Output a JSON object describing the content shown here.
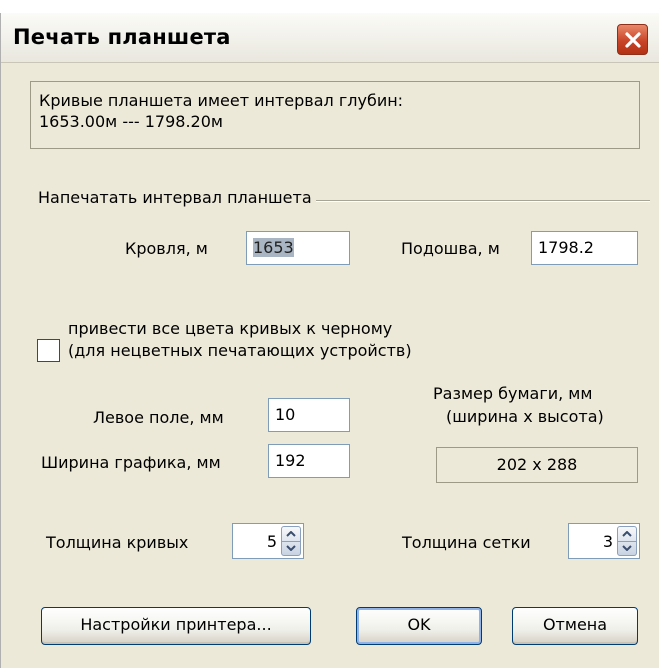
{
  "dialog": {
    "title": "Печать планшета",
    "close_icon": "close-x-icon"
  },
  "info": {
    "line1": "Кривые планшета имеет интервал глубин:",
    "line2": "1653.00м --- 1798.20м"
  },
  "print_interval": {
    "group_label": "Напечатать интервал планшета",
    "top_label": "Кровля, м",
    "top_value": "1653",
    "bottom_label": "Подошва, м",
    "bottom_value": "1798.2"
  },
  "black_colors": {
    "checked": false,
    "line1": "привести все цвета кривых к черному",
    "line2": "(для нецветных печатающих устройств)"
  },
  "margins": {
    "left_label": "Левое поле, мм",
    "left_value": "10",
    "width_label": "Ширина графика, мм",
    "width_value": "192"
  },
  "paper": {
    "label1": "Размер бумаги, мм",
    "label2": "(ширина х высота)",
    "value": "202 х 288"
  },
  "curve_thickness": {
    "label": "Толщина кривых",
    "value": "5"
  },
  "grid_thickness": {
    "label": "Толщина сетки",
    "value": "3"
  },
  "buttons": {
    "printer_settings": "Настройки принтера...",
    "ok": "OK",
    "cancel": "Отмена"
  },
  "colors": {
    "dialog_bg": "#ECE9D8",
    "close_button": "#C9452A",
    "field_border": "#7F9DB9",
    "selection_bg": "#A9B5C2"
  }
}
